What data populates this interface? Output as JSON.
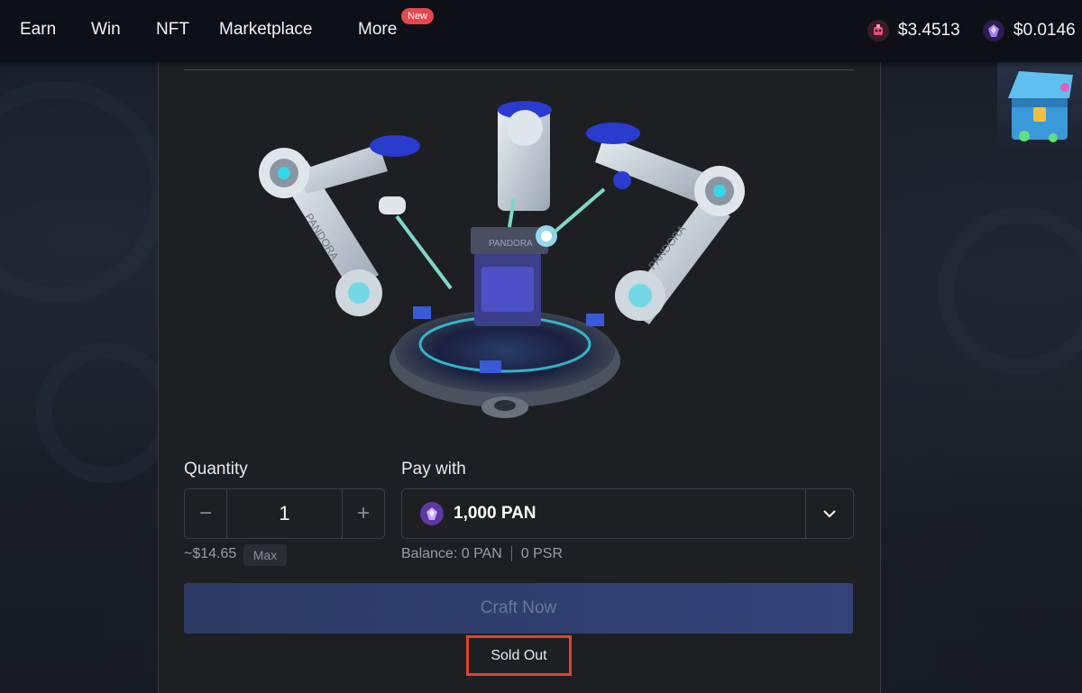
{
  "nav": {
    "items": [
      "Earn",
      "Win",
      "NFT",
      "Marketplace",
      "More"
    ],
    "new_badge": "New"
  },
  "balances": [
    {
      "icon": "pan-token-icon",
      "value": "$3.4513",
      "color": "#e84f7a"
    },
    {
      "icon": "psr-token-icon",
      "value": "$0.0146",
      "color": "#8a5cf6"
    }
  ],
  "craft": {
    "quantity_label": "Quantity",
    "quantity_value": "1",
    "minus": "−",
    "plus": "+",
    "usd_estimate": "~$14.65",
    "max_label": "Max",
    "pay_label": "Pay with",
    "pay_value": "1,000 PAN",
    "balance_prefix": "Balance:",
    "balance_pan": "0 PAN",
    "balance_psr": "0 PSR",
    "craft_button": "Craft Now",
    "status": "Sold Out"
  },
  "colors": {
    "accent": "#34437a",
    "highlight": "#e0452a",
    "badge": "#e5484d"
  }
}
